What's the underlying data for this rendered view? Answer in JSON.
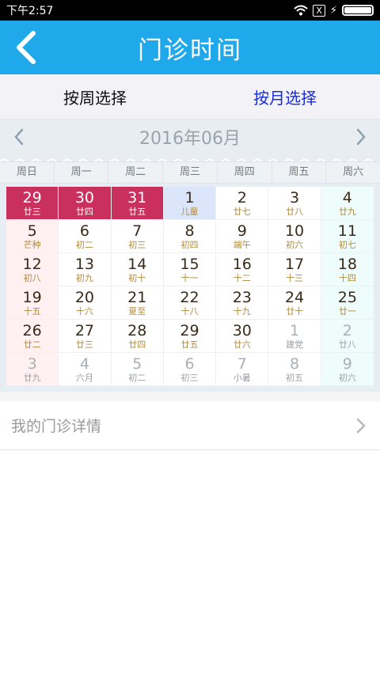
{
  "status_bar": {
    "time": "下午2:57",
    "x_badge": "X"
  },
  "header": {
    "title": "门诊时间",
    "back_icon": "back-chevron-icon"
  },
  "mode_tabs": {
    "week": "按周选择",
    "month": "按月选择",
    "active": "month"
  },
  "month_nav": {
    "title": "2016年06月"
  },
  "weekdays": [
    "周日",
    "周一",
    "周二",
    "周三",
    "周四",
    "周五",
    "周六"
  ],
  "calendar": {
    "days": [
      {
        "day": "29",
        "lunar": "廿三",
        "type": "selected"
      },
      {
        "day": "30",
        "lunar": "廿四",
        "type": "selected"
      },
      {
        "day": "31",
        "lunar": "廿五",
        "type": "selected"
      },
      {
        "day": "1",
        "lunar": "儿童",
        "type": "today"
      },
      {
        "day": "2",
        "lunar": "廿七",
        "type": "normal"
      },
      {
        "day": "3",
        "lunar": "廿八",
        "type": "normal"
      },
      {
        "day": "4",
        "lunar": "廿九",
        "type": "normal"
      },
      {
        "day": "5",
        "lunar": "芒种",
        "type": "normal"
      },
      {
        "day": "6",
        "lunar": "初二",
        "type": "normal"
      },
      {
        "day": "7",
        "lunar": "初三",
        "type": "normal"
      },
      {
        "day": "8",
        "lunar": "初四",
        "type": "normal"
      },
      {
        "day": "9",
        "lunar": "端午",
        "type": "normal"
      },
      {
        "day": "10",
        "lunar": "初六",
        "type": "normal"
      },
      {
        "day": "11",
        "lunar": "初七",
        "type": "normal"
      },
      {
        "day": "12",
        "lunar": "初八",
        "type": "normal"
      },
      {
        "day": "13",
        "lunar": "初九",
        "type": "normal"
      },
      {
        "day": "14",
        "lunar": "初十",
        "type": "normal"
      },
      {
        "day": "15",
        "lunar": "十一",
        "type": "normal"
      },
      {
        "day": "16",
        "lunar": "十二",
        "type": "normal"
      },
      {
        "day": "17",
        "lunar": "十三",
        "type": "normal"
      },
      {
        "day": "18",
        "lunar": "十四",
        "type": "normal"
      },
      {
        "day": "19",
        "lunar": "十五",
        "type": "normal"
      },
      {
        "day": "20",
        "lunar": "十六",
        "type": "normal"
      },
      {
        "day": "21",
        "lunar": "夏至",
        "type": "normal"
      },
      {
        "day": "22",
        "lunar": "十八",
        "type": "normal"
      },
      {
        "day": "23",
        "lunar": "十九",
        "type": "normal"
      },
      {
        "day": "24",
        "lunar": "廿十",
        "type": "normal"
      },
      {
        "day": "25",
        "lunar": "廿一",
        "type": "normal"
      },
      {
        "day": "26",
        "lunar": "廿二",
        "type": "normal"
      },
      {
        "day": "27",
        "lunar": "廿三",
        "type": "normal"
      },
      {
        "day": "28",
        "lunar": "廿四",
        "type": "normal"
      },
      {
        "day": "29",
        "lunar": "廿五",
        "type": "normal"
      },
      {
        "day": "30",
        "lunar": "廿六",
        "type": "normal"
      },
      {
        "day": "1",
        "lunar": "建党",
        "type": "other"
      },
      {
        "day": "2",
        "lunar": "廿八",
        "type": "other"
      },
      {
        "day": "3",
        "lunar": "廿九",
        "type": "other"
      },
      {
        "day": "4",
        "lunar": "六月",
        "type": "other"
      },
      {
        "day": "5",
        "lunar": "初二",
        "type": "other"
      },
      {
        "day": "6",
        "lunar": "初三",
        "type": "other"
      },
      {
        "day": "7",
        "lunar": "小暑",
        "type": "other"
      },
      {
        "day": "8",
        "lunar": "初五",
        "type": "other"
      },
      {
        "day": "9",
        "lunar": "初六",
        "type": "other"
      }
    ]
  },
  "detail": {
    "label": "我的门诊详情"
  },
  "colors": {
    "header_bg": "#1fa8ea",
    "selected_day_bg": "#c9305d",
    "active_tab": "#1a2bd6",
    "lunar_text": "#b28a3a"
  }
}
